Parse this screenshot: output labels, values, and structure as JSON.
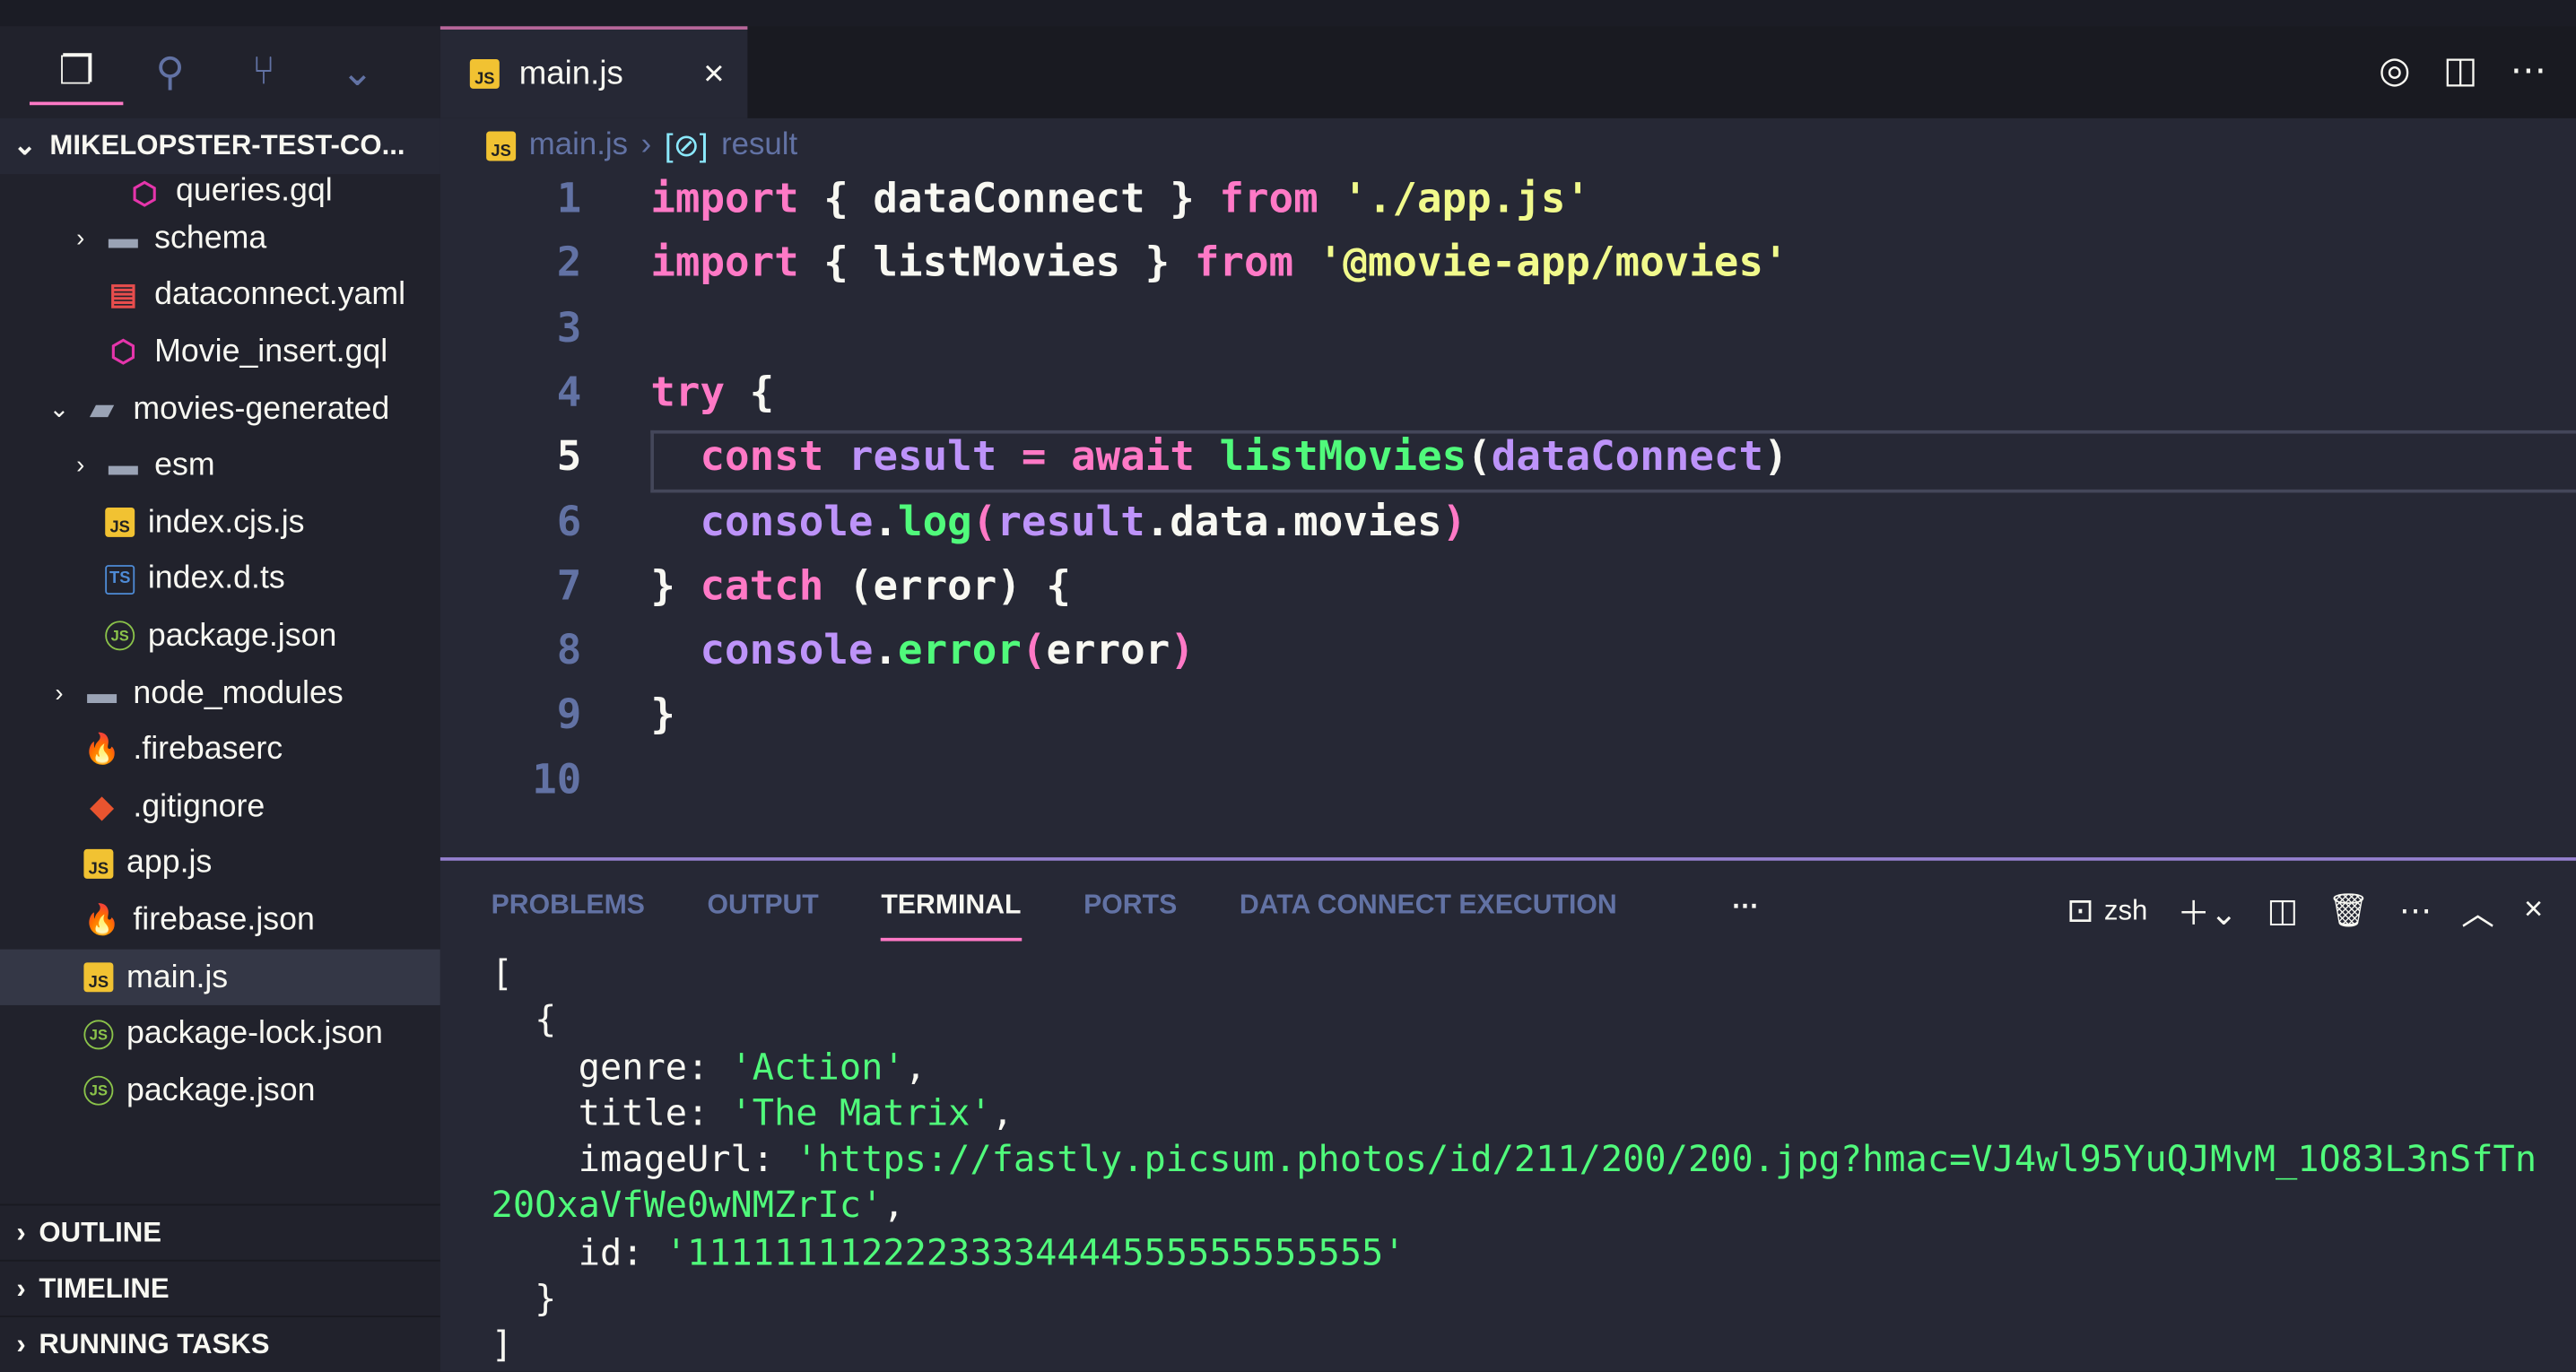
{
  "sidebar": {
    "root": "MIKELOPSTER-TEST-CO...",
    "items": [
      {
        "label": "queries.gql",
        "icon": "graphql-icon",
        "indent": 3,
        "chev": ""
      },
      {
        "label": "schema",
        "icon": "folder-icon",
        "indent": 2,
        "chev": "›"
      },
      {
        "label": "dataconnect.yaml",
        "icon": "yaml-icon",
        "indent": 2,
        "chev": ""
      },
      {
        "label": "Movie_insert.gql",
        "icon": "graphql-icon",
        "indent": 2,
        "chev": ""
      },
      {
        "label": "movies-generated",
        "icon": "folder-open-icon",
        "indent": 1,
        "chev": "⌄"
      },
      {
        "label": "esm",
        "icon": "folder-icon",
        "indent": 2,
        "chev": "›"
      },
      {
        "label": "index.cjs.js",
        "icon": "js-icon",
        "indent": 2,
        "chev": ""
      },
      {
        "label": "index.d.ts",
        "icon": "ts-icon",
        "indent": 2,
        "chev": ""
      },
      {
        "label": "package.json",
        "icon": "json-icon",
        "indent": 2,
        "chev": ""
      },
      {
        "label": "node_modules",
        "icon": "folder-icon",
        "indent": 1,
        "chev": "›"
      },
      {
        "label": ".firebaserc",
        "icon": "firebase-icon",
        "indent": 1,
        "chev": ""
      },
      {
        "label": ".gitignore",
        "icon": "git-icon",
        "indent": 1,
        "chev": ""
      },
      {
        "label": "app.js",
        "icon": "js-icon",
        "indent": 1,
        "chev": ""
      },
      {
        "label": "firebase.json",
        "icon": "firebase-icon",
        "indent": 1,
        "chev": ""
      },
      {
        "label": "main.js",
        "icon": "js-icon",
        "indent": 1,
        "chev": "",
        "selected": true
      },
      {
        "label": "package-lock.json",
        "icon": "json-icon",
        "indent": 1,
        "chev": ""
      },
      {
        "label": "package.json",
        "icon": "json-icon",
        "indent": 1,
        "chev": ""
      }
    ],
    "sections": [
      "OUTLINE",
      "TIMELINE",
      "RUNNING TASKS"
    ]
  },
  "tab": {
    "label": "main.js",
    "icon_text": "JS"
  },
  "breadcrumb": {
    "file": "main.js",
    "symbol": "result"
  },
  "code": {
    "current_line": 5,
    "lines": [
      [
        [
          "k",
          "import"
        ],
        [
          "w",
          " { dataConnect } "
        ],
        [
          "k",
          "from"
        ],
        [
          "w",
          " "
        ],
        [
          "s",
          "'./app.js'"
        ]
      ],
      [
        [
          "k",
          "import"
        ],
        [
          "w",
          " { listMovies } "
        ],
        [
          "k",
          "from"
        ],
        [
          "w",
          " "
        ],
        [
          "s",
          "'@movie-app/movies'"
        ]
      ],
      [],
      [
        [
          "k",
          "try"
        ],
        [
          "w",
          " {"
        ]
      ],
      [
        [
          "w",
          "  "
        ],
        [
          "k",
          "const"
        ],
        [
          "w",
          " "
        ],
        [
          "v",
          "result"
        ],
        [
          "w",
          " "
        ],
        [
          "k",
          "="
        ],
        [
          "w",
          " "
        ],
        [
          "k",
          "await"
        ],
        [
          "w",
          " "
        ],
        [
          "f",
          "listMovies"
        ],
        [
          "w",
          "("
        ],
        [
          "v",
          "dataConnect"
        ],
        [
          "w",
          ")"
        ]
      ],
      [
        [
          "w",
          "  "
        ],
        [
          "v",
          "console"
        ],
        [
          "w",
          "."
        ],
        [
          "f",
          "log"
        ],
        [
          "k",
          "("
        ],
        [
          "v",
          "result"
        ],
        [
          "w",
          ".data.movies"
        ],
        [
          "k",
          ")"
        ]
      ],
      [
        [
          "w",
          "} "
        ],
        [
          "k",
          "catch"
        ],
        [
          "w",
          " (error) {"
        ]
      ],
      [
        [
          "w",
          "  "
        ],
        [
          "v",
          "console"
        ],
        [
          "w",
          "."
        ],
        [
          "f",
          "error"
        ],
        [
          "k",
          "("
        ],
        [
          "w",
          "error"
        ],
        [
          "k",
          ")"
        ]
      ],
      [
        [
          "w",
          "}"
        ]
      ],
      []
    ]
  },
  "panel": {
    "tabs": [
      "PROBLEMS",
      "OUTPUT",
      "TERMINAL",
      "PORTS",
      "DATA CONNECT EXECUTION"
    ],
    "active": "TERMINAL",
    "shell": "zsh"
  },
  "terminal": {
    "open_bracket": "[",
    "open_brace": "  {",
    "genre_key": "    genre: ",
    "genre_val": "'Action'",
    "title_key": "    title: ",
    "title_val": "'The Matrix'",
    "image_key": "    imageUrl: ",
    "image_val": "'https://fastly.picsum.photos/id/211/200/200.jpg?hmac=VJ4wl95YuQJMvM_1O83L3nSfTn20OxaVfWe0wNMZrIc'",
    "id_key": "    id: ",
    "id_val": "'11111111222233334444555555555555'",
    "close_brace": "  }",
    "close_bracket": "]"
  },
  "colors": {
    "keyword": "#ff79c6",
    "string": "#f1fa8c",
    "function": "#50fa7b",
    "variable": "#bd93f9",
    "accent": "#ff79c6"
  }
}
